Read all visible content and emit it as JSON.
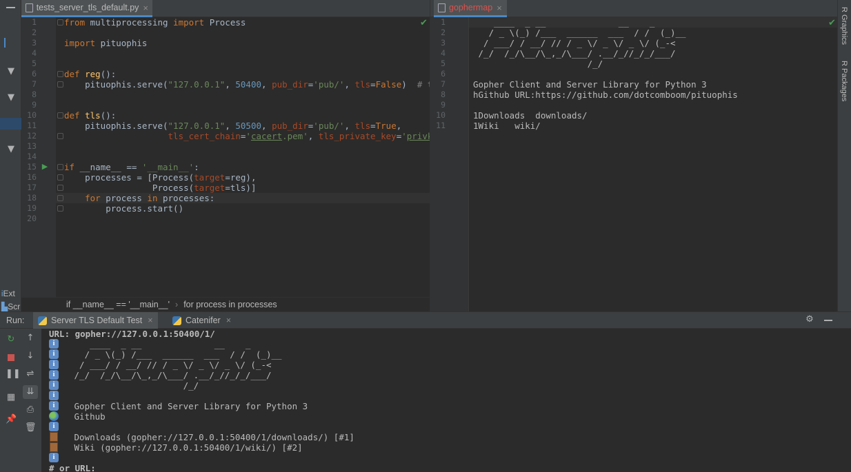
{
  "editor_left": {
    "tab_label": "tests_server_tls_default.py",
    "line_numbers": [
      "1",
      "2",
      "3",
      "4",
      "5",
      "6",
      "7",
      "8",
      "9",
      "10",
      "11",
      "12",
      "13",
      "14",
      "15",
      "16",
      "17",
      "18",
      "19",
      "20"
    ]
  },
  "editor_right": {
    "tab_label": "gophermap",
    "line_numbers": [
      "1",
      "2",
      "3",
      "4",
      "5",
      "6",
      "7",
      "8",
      "9",
      "10",
      "11"
    ],
    "lines": [
      "    ____  _ __              __    _",
      "   / _ \\(_) /___  ______  ___  / /  (_)__",
      "  / ___/ / __/ // / _ \\/ _ \\/ _ \\/ (_-<",
      " /_/  /_/\\__/\\_,_/\\___/ .__/_//_/_/___/",
      "                      /_/",
      "",
      "Gopher Client and Server Library for Python 3",
      "hGithub URL:https://github.com/dotcomboom/pituophis",
      "",
      "1Downloads  downloads/",
      "1Wiki   wiki/"
    ]
  },
  "breadcrumb": {
    "item1": "if __name__ == '__main__'",
    "item2": "for process in processes"
  },
  "left_strip": {
    "item_ext": "Ext",
    "item_scr": "Scr"
  },
  "right_strip": {
    "r_graphics": "R Graphics",
    "r_packages": "R Packages"
  },
  "run_panel": {
    "label": "Run:",
    "tabs": [
      "Server TLS Default Test",
      "Catenifer"
    ],
    "console": [
      "URL: gopher://127.0.0.1:50400/1/",
      "    ____  _ __              __    _",
      "   / _ \\(_) /___  ______  ___  / /  (_)__",
      "  / ___/ / __/ // / _ \\/ _ \\/ _ \\/ (_-<",
      " /_/  /_/\\__/\\_,_/\\___/ .__/_//_/_/___/",
      "                      /_/",
      "",
      " Gopher Client and Server Library for Python 3",
      " Github",
      "",
      " Downloads (gopher://127.0.0.1:50400/1/downloads/) [#1]",
      " Wiki (gopher://127.0.0.1:50400/1/wiki/) [#2]",
      "",
      "# or URL:"
    ]
  },
  "colors": {
    "background": "#2b2b2b",
    "panel": "#3c3f41",
    "keyword": "#cc7832",
    "string": "#6a8759",
    "number": "#6897bb",
    "parameter": "#aa4926"
  }
}
